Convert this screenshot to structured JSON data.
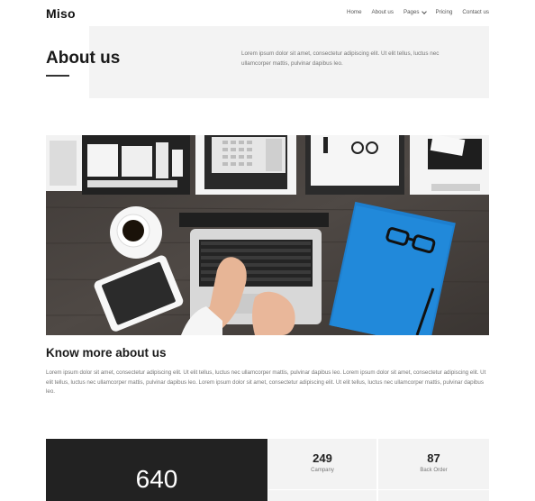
{
  "header": {
    "logo": "Miso",
    "nav": [
      {
        "label": "Home"
      },
      {
        "label": "About us"
      },
      {
        "label": "Pages",
        "has_dropdown": true
      },
      {
        "label": "Pricing"
      },
      {
        "label": "Contact us"
      }
    ]
  },
  "hero": {
    "title": "About us",
    "text": "Lorem ipsum dolor sit amet, consectetur adipiscing elit. Ut elit tellus, luctus nec ullamcorper mattis, pulvinar dapibus leo."
  },
  "photo": {
    "subject": "top-down office desk with laptop, tablet, coffee cup, glasses and blue folder"
  },
  "about": {
    "title": "Know more about us",
    "text": "Lorem ipsum dolor sit amet, consectetur adipiscing elit. Ut elit tellus, luctus nec ullamcorper mattis, pulvinar dapibus leo. Lorem ipsum dolor sit amet, consectetur adipiscing elit. Ut elit tellus, luctus nec ullamcorper mattis, pulvinar dapibus leo. Lorem ipsum dolor sit amet, consectetur adipiscing elit. Ut elit tellus, luctus nec ullamcorper mattis, pulvinar dapibus leo."
  },
  "stats": {
    "main": {
      "value": "640"
    },
    "items": [
      {
        "value": "249",
        "label": "Campany"
      },
      {
        "value": "87",
        "label": "Back Order"
      }
    ]
  },
  "colors": {
    "dark": "#222222",
    "light_bg": "#f3f3f3",
    "muted_text": "#777777",
    "folder_blue": "#1a7fd0"
  }
}
